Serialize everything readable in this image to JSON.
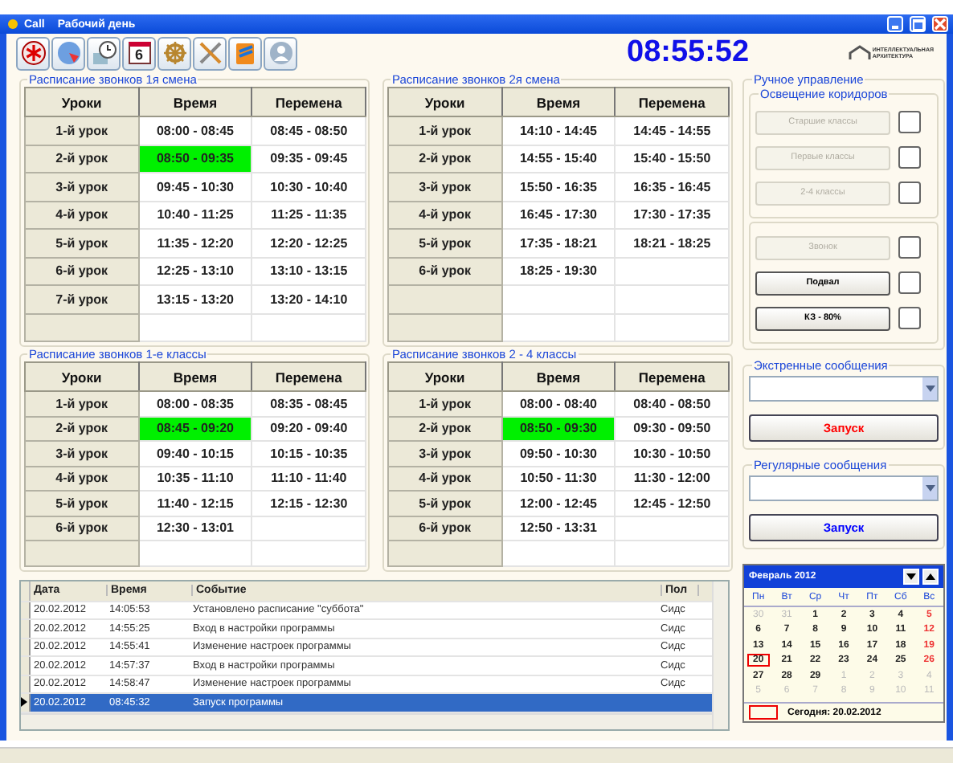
{
  "window": {
    "title_items": [
      "Call",
      "Рабочий день"
    ]
  },
  "toolbar": [
    {
      "kind": "asterisk"
    },
    {
      "kind": "globe"
    },
    {
      "kind": "clock"
    },
    {
      "kind": "calendar",
      "label": "6"
    },
    {
      "kind": "wheel"
    },
    {
      "kind": "tools"
    },
    {
      "kind": "book"
    },
    {
      "kind": "person"
    }
  ],
  "clock": "08:55:52",
  "logo": {
    "lines": [
      "ИНТЕЛЛЕКТУАЛЬНАЯ",
      "АРХИТЕКТУРА"
    ]
  },
  "schedules": [
    {
      "title": "Расписание звонков 1я смена",
      "columns": [
        "Уроки",
        "Время",
        "Перемена"
      ],
      "rows": [
        {
          "lesson": "1-й урок",
          "time": "08:00 - 08:45",
          "break": "08:45 - 08:50",
          "current": false
        },
        {
          "lesson": "2-й урок",
          "time": "08:50 - 09:35",
          "break": "09:35 - 09:45",
          "current": true
        },
        {
          "lesson": "3-й урок",
          "time": "09:45 - 10:30",
          "break": "10:30 - 10:40",
          "current": false
        },
        {
          "lesson": "4-й урок",
          "time": "10:40 - 11:25",
          "break": "11:25 - 11:35",
          "current": false
        },
        {
          "lesson": "5-й урок",
          "time": "11:35 - 12:20",
          "break": "12:20 - 12:25",
          "current": false
        },
        {
          "lesson": "6-й урок",
          "time": "12:25 - 13:10",
          "break": "13:10 - 13:15",
          "current": false
        },
        {
          "lesson": "7-й урок",
          "time": "13:15 - 13:20",
          "break": "13:20 - 14:10",
          "current": false
        }
      ]
    },
    {
      "title": "Расписание звонков 2я смена",
      "columns": [
        "Уроки",
        "Время",
        "Перемена"
      ],
      "rows": [
        {
          "lesson": "1-й урок",
          "time": "14:10 - 14:45",
          "break": "14:45 - 14:55",
          "current": false
        },
        {
          "lesson": "2-й урок",
          "time": "14:55 - 15:40",
          "break": "15:40 - 15:50",
          "current": false
        },
        {
          "lesson": "3-й урок",
          "time": "15:50 - 16:35",
          "break": "16:35 - 16:45",
          "current": false
        },
        {
          "lesson": "4-й урок",
          "time": "16:45 - 17:30",
          "break": "17:30 - 17:35",
          "current": false
        },
        {
          "lesson": "5-й урок",
          "time": "17:35 - 18:21",
          "break": "18:21 - 18:25",
          "current": false
        },
        {
          "lesson": "6-й урок",
          "time": "18:25 - 19:30",
          "current": false
        }
      ]
    },
    {
      "title": "Расписание звонков 1-е классы",
      "columns": [
        "Уроки",
        "Время",
        "Перемена"
      ],
      "rows": [
        {
          "lesson": "1-й урок",
          "time": "08:00 - 08:35",
          "break": "08:35 - 08:45",
          "current": false
        },
        {
          "lesson": "2-й урок",
          "time": "08:45 - 09:20",
          "break": "09:20 - 09:40",
          "current": true
        },
        {
          "lesson": "3-й урок",
          "time": "09:40 - 10:15",
          "break": "10:15 - 10:35",
          "current": false
        },
        {
          "lesson": "4-й урок",
          "time": "10:35 - 11:10",
          "break": "11:10 - 11:40",
          "current": false
        },
        {
          "lesson": "5-й урок",
          "time": "11:40 - 12:15",
          "break": "12:15 - 12:30",
          "current": false
        },
        {
          "lesson": "6-й урок",
          "time": "12:30 - 13:01",
          "current": false
        }
      ]
    },
    {
      "title": "Расписание звонков 2 - 4 классы",
      "columns": [
        "Уроки",
        "Время",
        "Перемена"
      ],
      "rows": [
        {
          "lesson": "1-й урок",
          "time": "08:00 - 08:40",
          "break": "08:40 - 08:50",
          "current": false
        },
        {
          "lesson": "2-й урок",
          "time": "08:50 - 09:30",
          "break": "09:30 - 09:50",
          "current": true
        },
        {
          "lesson": "3-й урок",
          "time": "09:50 - 10:30",
          "break": "10:30 - 10:50",
          "current": false
        },
        {
          "lesson": "4-й урок",
          "time": "10:50 - 11:30",
          "break": "11:30 - 12:00",
          "current": false
        },
        {
          "lesson": "5-й урок",
          "time": "12:00 - 12:45",
          "break": "12:45 - 12:50",
          "current": false
        },
        {
          "lesson": "6-й урок",
          "time": "12:50 - 13:31",
          "current": false
        }
      ]
    }
  ],
  "manual": {
    "title": "Ручное управление",
    "lighting_title": "Освещение коридоров",
    "lighting": [
      {
        "label": "Старшие классы",
        "disabled": true,
        "checked": false
      },
      {
        "label": "Первые классы",
        "disabled": true,
        "checked": false
      },
      {
        "label": "2-4 классы",
        "disabled": true,
        "checked": false
      }
    ],
    "other": [
      {
        "label": "Звонок",
        "disabled": true,
        "checked": false
      },
      {
        "label": "Подвал",
        "disabled": false,
        "checked": false
      },
      {
        "label": "КЗ - 80%",
        "disabled": false,
        "checked": false
      }
    ]
  },
  "messages": [
    {
      "title": "Экстренные сообщения",
      "button": "Запуск",
      "color": "#ff0000"
    },
    {
      "title": "Регулярные сообщения",
      "button": "Запуск",
      "color": "#0000ff"
    }
  ],
  "log": {
    "columns": [
      "Дата",
      "Время",
      "Событие",
      "Пол"
    ],
    "rows": [
      {
        "date": "20.02.2012",
        "time": "14:05:53",
        "event": "Установлено расписание \"суббота\"",
        "user": "Сидс",
        "selected": false
      },
      {
        "date": "20.02.2012",
        "time": "14:55:25",
        "event": "Вход в настройки программы",
        "user": "Сидс",
        "selected": false
      },
      {
        "date": "20.02.2012",
        "time": "14:55:41",
        "event": "Изменение настроек программы",
        "user": "Сидс",
        "selected": false
      },
      {
        "date": "20.02.2012",
        "time": "14:57:37",
        "event": "Вход в настройки программы",
        "user": "Сидс",
        "selected": false
      },
      {
        "date": "20.02.2012",
        "time": "14:58:47",
        "event": "Изменение настроек программы",
        "user": "Сидс",
        "selected": false
      },
      {
        "date": "20.02.2012",
        "time": "08:45:32",
        "event": "Запуск программы",
        "selected": true
      }
    ]
  },
  "calendar": {
    "month": "Февраль 2012",
    "weekdays": [
      "Пн",
      "Вт",
      "Ср",
      "Чт",
      "Пт",
      "Сб",
      "Вс"
    ],
    "weeks": [
      [
        {
          "d": "30",
          "other": true
        },
        {
          "d": "31",
          "other": true
        },
        {
          "d": "1"
        },
        {
          "d": "2"
        },
        {
          "d": "3"
        },
        {
          "d": "4"
        },
        {
          "d": "5",
          "holiday": true
        }
      ],
      [
        {
          "d": "6"
        },
        {
          "d": "7"
        },
        {
          "d": "8"
        },
        {
          "d": "9"
        },
        {
          "d": "10"
        },
        {
          "d": "11"
        },
        {
          "d": "12",
          "holiday": true
        }
      ],
      [
        {
          "d": "13"
        },
        {
          "d": "14"
        },
        {
          "d": "15"
        },
        {
          "d": "16"
        },
        {
          "d": "17"
        },
        {
          "d": "18"
        },
        {
          "d": "19",
          "holiday": true
        }
      ],
      [
        {
          "d": "20",
          "selected": true
        },
        {
          "d": "21"
        },
        {
          "d": "22"
        },
        {
          "d": "23"
        },
        {
          "d": "24"
        },
        {
          "d": "25"
        },
        {
          "d": "26",
          "holiday": true
        }
      ],
      [
        {
          "d": "27"
        },
        {
          "d": "28"
        },
        {
          "d": "29"
        },
        {
          "d": "1",
          "other": true
        },
        {
          "d": "2",
          "other": true
        },
        {
          "d": "3",
          "other": true
        },
        {
          "d": "4",
          "other": true
        }
      ],
      [
        {
          "d": "5",
          "other": true
        },
        {
          "d": "6",
          "other": true
        },
        {
          "d": "7",
          "other": true
        },
        {
          "d": "8",
          "other": true
        },
        {
          "d": "9",
          "other": true
        },
        {
          "d": "10",
          "other": true
        },
        {
          "d": "11",
          "other": true
        }
      ]
    ],
    "today": "Сегодня:  20.02.2012"
  }
}
